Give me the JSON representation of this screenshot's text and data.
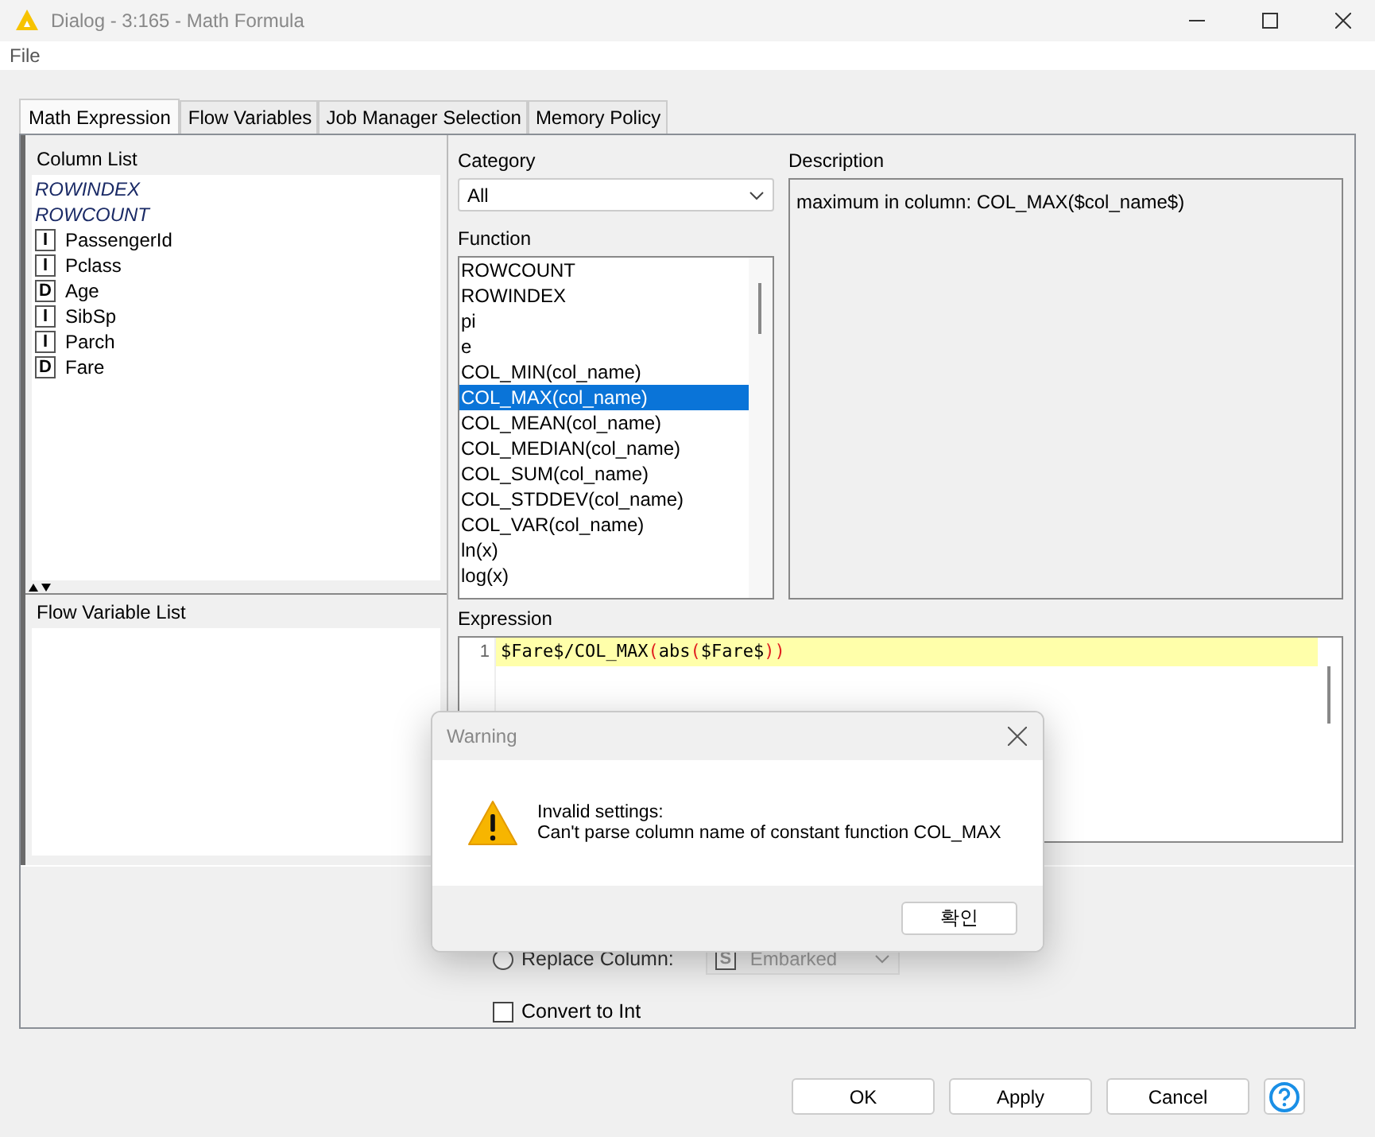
{
  "window": {
    "title": "Dialog - 3:165 - Math Formula"
  },
  "menu": [
    "File"
  ],
  "tabs": [
    {
      "label": "Math Expression",
      "selected": true
    },
    {
      "label": "Flow Variables",
      "selected": false
    },
    {
      "label": "Job Manager Selection",
      "selected": false
    },
    {
      "label": "Memory Policy",
      "selected": false
    }
  ],
  "column_list": {
    "title": "Column List",
    "items": [
      {
        "kind": "special",
        "name": "ROWINDEX"
      },
      {
        "kind": "special",
        "name": "ROWCOUNT"
      },
      {
        "kind": "column",
        "type": "I",
        "name": "PassengerId"
      },
      {
        "kind": "column",
        "type": "I",
        "name": "Pclass"
      },
      {
        "kind": "column",
        "type": "D",
        "name": "Age"
      },
      {
        "kind": "column",
        "type": "I",
        "name": "SibSp"
      },
      {
        "kind": "column",
        "type": "I",
        "name": "Parch"
      },
      {
        "kind": "column",
        "type": "D",
        "name": "Fare"
      }
    ]
  },
  "flow_variable_list": {
    "title": "Flow Variable List"
  },
  "category": {
    "label": "Category",
    "value": "All"
  },
  "function_list": {
    "label": "Function",
    "items": [
      {
        "name": "ROWCOUNT",
        "selected": false
      },
      {
        "name": "ROWINDEX",
        "selected": false
      },
      {
        "name": "pi",
        "selected": false
      },
      {
        "name": "e",
        "selected": false
      },
      {
        "name": "COL_MIN(col_name)",
        "selected": false
      },
      {
        "name": "COL_MAX(col_name)",
        "selected": true
      },
      {
        "name": "COL_MEAN(col_name)",
        "selected": false
      },
      {
        "name": "COL_MEDIAN(col_name)",
        "selected": false
      },
      {
        "name": "COL_SUM(col_name)",
        "selected": false
      },
      {
        "name": "COL_STDDEV(col_name)",
        "selected": false
      },
      {
        "name": "COL_VAR(col_name)",
        "selected": false
      },
      {
        "name": "ln(x)",
        "selected": false
      },
      {
        "name": "log(x)",
        "selected": false
      }
    ]
  },
  "description": {
    "label": "Description",
    "text": "maximum in column: COL_MAX($col_name$)"
  },
  "expression": {
    "label": "Expression",
    "lines": [
      {
        "number": "1",
        "tokens": [
          {
            "kind": "plain",
            "text": "$Fare$/COL_MAX"
          },
          {
            "kind": "paren",
            "text": "("
          },
          {
            "kind": "plain",
            "text": "abs"
          },
          {
            "kind": "paren",
            "text": "("
          },
          {
            "kind": "plain",
            "text": "$Fare$"
          },
          {
            "kind": "paren",
            "text": "))"
          }
        ]
      }
    ]
  },
  "replace_column": {
    "label": "Replace Column:",
    "selected": false,
    "type": "S",
    "value": "Embarked",
    "disabled": true
  },
  "convert_to_int": {
    "label": "Convert to Int",
    "checked": false
  },
  "buttons": [
    "OK",
    "Apply",
    "Cancel"
  ],
  "warning": {
    "title": "Warning",
    "heading": "Invalid settings:",
    "message": "Can't parse column name of constant function COL_MAX",
    "button": "확인"
  }
}
